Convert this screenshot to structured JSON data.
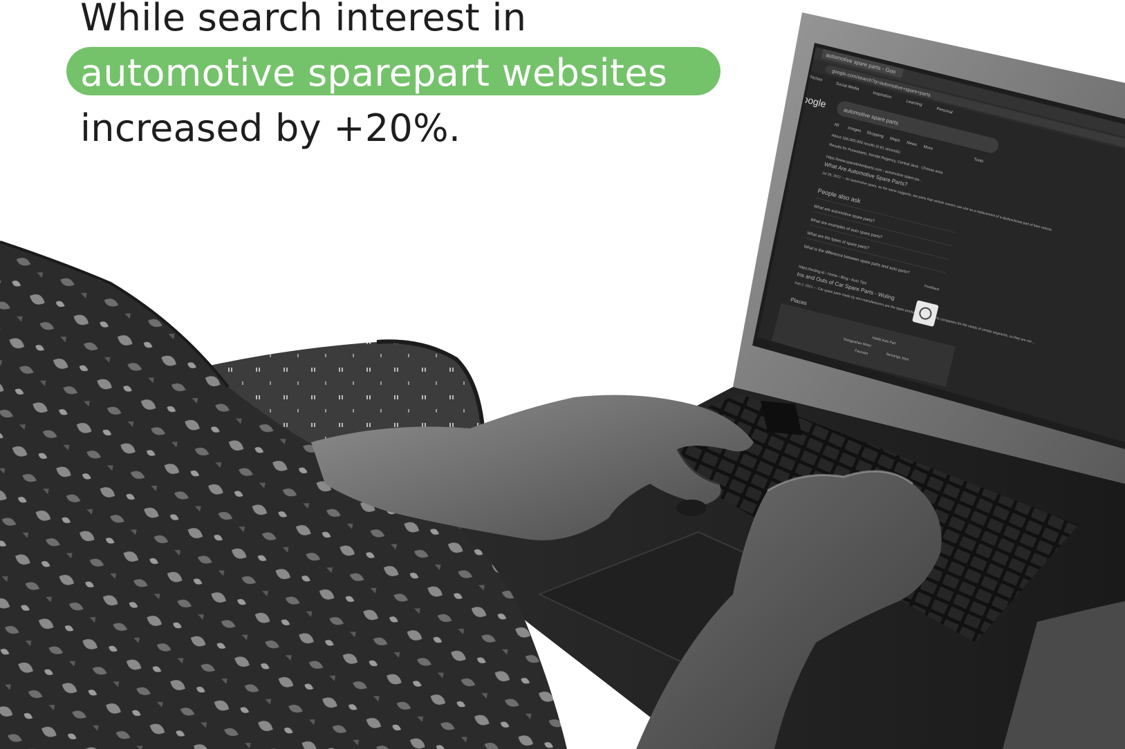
{
  "headline": {
    "line1": "While search interest in",
    "line2": "automotive sparepart websites",
    "line3": "increased by +20%."
  },
  "colors": {
    "highlight": "#74c26a",
    "headline_text": "#1e1e1e",
    "highlight_text": "#ffffff"
  },
  "laptop_screen": {
    "tab_title": "automotive spare parts - Goo",
    "url": "google.com/search?q=automotive+spare+parts",
    "bookmarks": [
      "Apps",
      "Pitches",
      "Social Media",
      "Inspiration",
      "Learning",
      "Personal"
    ],
    "search_logo": "Google",
    "search_query": "automotive spare parts",
    "search_tabs": [
      "All",
      "Images",
      "Shopping",
      "Maps",
      "News",
      "More"
    ],
    "tools_label": "Tools",
    "results_count": "About 166,000,000 results (0.61 seconds)",
    "location_note": "Results for Purwokarto, Kendal Regency, Central Java · Choose area",
    "result1": {
      "url": "https://www.spacelinkedparts.com › automotive-spare-pa...",
      "title": "What Are Automotive Spare Parts?",
      "snippet": "Jul 28, 2022 — An automotive spare, as the name suggests, are parts that vehicle owners can use as a replacement of a dysfunctional part of their vehicle."
    },
    "people_also_ask": {
      "heading": "People also ask",
      "questions": [
        "What are automotive spare parts?",
        "What are examples of auto spare parts?",
        "What are the types of spare parts?",
        "What is the difference between spare parts and auto parts?"
      ],
      "feedback": "Feedback"
    },
    "result2": {
      "url": "https://wuling.id › Home › Blog › Auto Tips",
      "title": "Ins and Outs of Car Spare Parts - Wuling",
      "snippet": "Feb 2, 2021 — Car spare parts made by non-manufacturers are the types produced by auto parts companies for the needs of certain segments, so they are not ..."
    },
    "places_heading": "Places",
    "map_labels": [
      "Habib Auto Part",
      "Sanggrahan Motor",
      "Fauzaan",
      "Semanga Jaya"
    ]
  }
}
